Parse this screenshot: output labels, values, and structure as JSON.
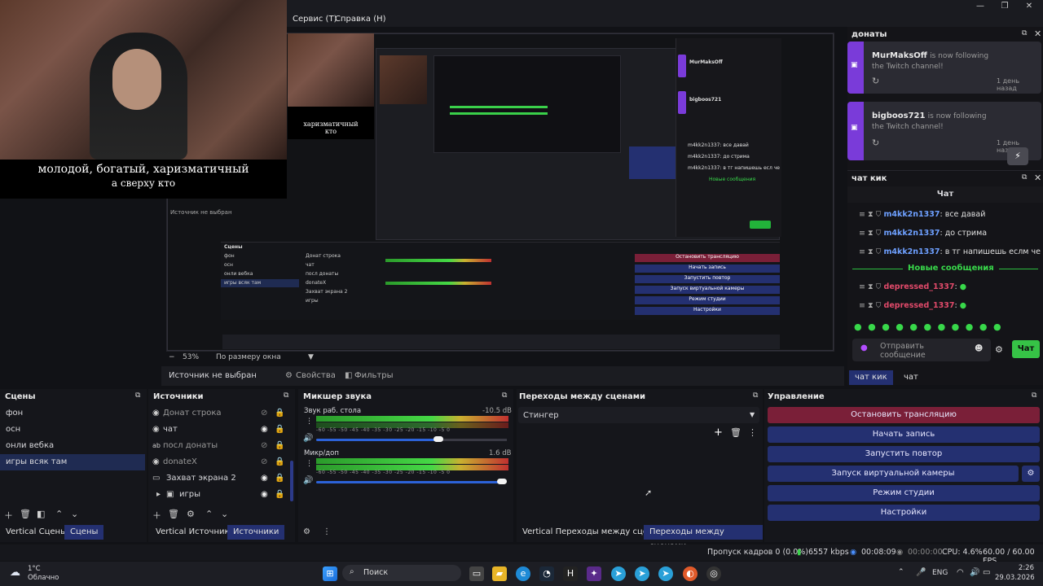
{
  "menu": {
    "service": "Сервис (Т)",
    "help": "Справка (Н)"
  },
  "window_controls": [
    "—",
    "❐",
    "✕"
  ],
  "webcam": {
    "caption_line1": "молодой, богатый, харизматичный",
    "caption_line2": "а сверху кто"
  },
  "nested_preview": {
    "caption_line1": "харизматичный",
    "caption_line2": "кто",
    "source_label": "Источник не выбран",
    "scenes": [
      "фон",
      "осн",
      "онли вебка",
      "игры всяк там"
    ],
    "sources": [
      "Донат строка",
      "чат",
      "посл донаты",
      "donateX",
      "Захват экрана 2",
      "игры"
    ],
    "controls": [
      "Остановить трансляцию",
      "Начать запись",
      "Запустить повтор",
      "Запуск виртуальной камеры",
      "Режим студии",
      "Настройки"
    ],
    "chat_lines": [
      "m4kk2n1337: все давай",
      "m4kk2n1337: до стрима",
      "m4kk2n1337: в тг напишешь есл че"
    ],
    "follow_users": [
      "MurMaksOff",
      "bigboos721"
    ]
  },
  "zoom": {
    "value": "53%",
    "mode": "По размеру окна"
  },
  "source_bar": {
    "label": "Источник не выбран",
    "properties": "Свойства",
    "filters": "Фильтры"
  },
  "scenes": {
    "title": "Сцены",
    "items": [
      "фон",
      "осн",
      "онли вебка",
      "игры всяк там"
    ],
    "tabs": [
      "Vertical Сцены",
      "Сцены"
    ]
  },
  "sources": {
    "title": "Источники",
    "items": [
      {
        "label": "Донат строка",
        "icon": "globe-icon",
        "hidden": true
      },
      {
        "label": "чат",
        "icon": "globe-icon",
        "hidden": false
      },
      {
        "label": "посл донаты",
        "icon": "text-icon",
        "hidden": true
      },
      {
        "label": "donateX",
        "icon": "globe-icon",
        "hidden": true
      },
      {
        "label": "Захват экрана 2",
        "icon": "monitor-icon",
        "hidden": false
      },
      {
        "label": "игры",
        "icon": "folder-icon",
        "hidden": false
      }
    ],
    "tabs": [
      "Vertical Источники",
      "Источники"
    ]
  },
  "mixer": {
    "title": "Микшер звука",
    "channels": [
      {
        "name": "Звук раб. стола",
        "db": "-10.5 dB",
        "level": 0.92
      },
      {
        "name": "Микр/доп",
        "db": "1.6 dB",
        "level": 1.0
      }
    ],
    "ticks": "-60 -55 -50 -45 -40 -35 -30 -25 -20 -15 -10 -5 0"
  },
  "transitions": {
    "title": "Переходы между сценами",
    "selected": "Стингер",
    "tabs": [
      "Vertical Переходы между сценами",
      "Переходы между сценами"
    ]
  },
  "controls": {
    "title": "Управление",
    "buttons": [
      "Остановить трансляцию",
      "Начать запись",
      "Запустить повтор",
      "Запуск виртуальной камеры",
      "Режим студии",
      "Настройки"
    ]
  },
  "donations": {
    "title": "донаты",
    "items": [
      {
        "user": "MurMaksOff",
        "text": "is now following",
        "sub": "the Twitch channel!",
        "time": "1 день назад"
      },
      {
        "user": "bigboos721",
        "text": "is now following",
        "sub": "the Twitch channel!",
        "time": "1 день назад"
      }
    ]
  },
  "chat": {
    "dock_title": "чат кик",
    "header": "Чат",
    "messages": [
      {
        "nick": "m4kk2n1337",
        "text": ": все давай"
      },
      {
        "nick": "m4kk2n1337",
        "text": ": до стрима"
      },
      {
        "nick": "m4kk2n1337",
        "text": ": в тг напишешь еслм че"
      }
    ],
    "new_messages": "Новые сообщения",
    "messages2": [
      {
        "nick": "depressed_1337",
        "text": ":"
      },
      {
        "nick": "depressed_1337",
        "text": ":"
      }
    ],
    "input_placeholder": "Отправить сообщение",
    "send": "Чат",
    "tabs": [
      "чат кик",
      "чат"
    ]
  },
  "status": {
    "dropped": "Пропуск кадров 0 (0.0%)",
    "bitrate": "6557 kbps",
    "live_time": "00:08:09",
    "rec_time": "00:00:00",
    "cpu": "CPU: 4.6%",
    "fps": "60.00 / 60.00 FPS"
  },
  "taskbar": {
    "weather_temp": "1°C",
    "weather_desc": "Облачно",
    "search": "Поиск",
    "lang": "ENG",
    "time": "2:26",
    "date": "29.03.2026"
  }
}
